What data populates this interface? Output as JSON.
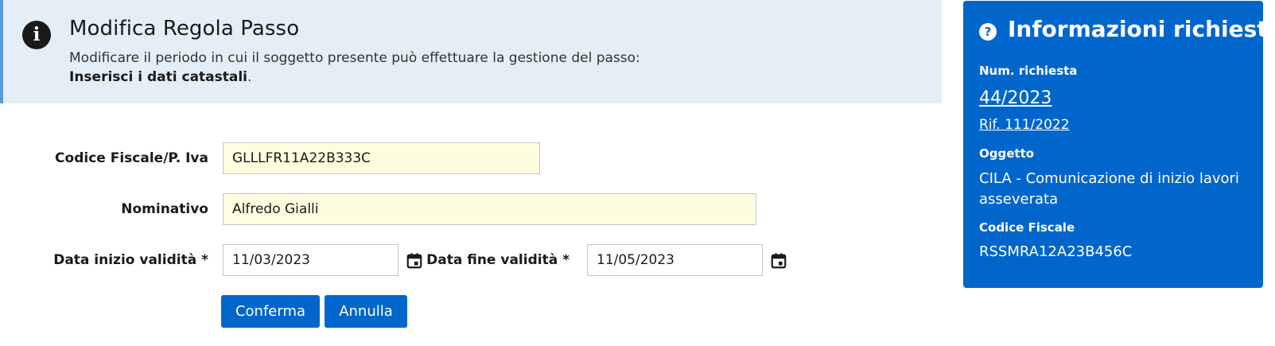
{
  "header": {
    "title": "Modifica Regola Passo",
    "description": "Modificare il periodo in cui il soggetto presente può effettuare la gestione del passo:",
    "instruction_bold": "Inserisci i dati catastali",
    "instruction_suffix": ".",
    "icon": "info-icon"
  },
  "form": {
    "codice_fiscale": {
      "label": "Codice Fiscale/P. Iva",
      "value": "GLLLFR11A22B333C"
    },
    "nominativo": {
      "label": "Nominativo",
      "value": "Alfredo Gialli"
    },
    "data_inizio": {
      "label": "Data inizio validità *",
      "value": "11/03/2023",
      "icon": "calendar-icon"
    },
    "data_fine": {
      "label": "Data fine validità *",
      "value": "11/05/2023",
      "icon": "calendar-icon"
    },
    "confirm_label": "Conferma",
    "cancel_label": "Annulla"
  },
  "side_panel": {
    "title": "Informazioni richiesta",
    "icon": "help-icon",
    "num_richiesta_label": "Num. richiesta",
    "num_richiesta_value": "44/2023",
    "riferimento": "Rif. 111/2022",
    "oggetto_label": "Oggetto",
    "oggetto_value": "CILA - Comunicazione di inizio lavori asseverata",
    "codice_fiscale_label": "Codice Fiscale",
    "codice_fiscale_value": "RSSMRA12A23B456C"
  },
  "colors": {
    "primary": "#0066cc",
    "header_bg": "#e4eef6",
    "readonly_field_bg": "#fdfde0"
  }
}
